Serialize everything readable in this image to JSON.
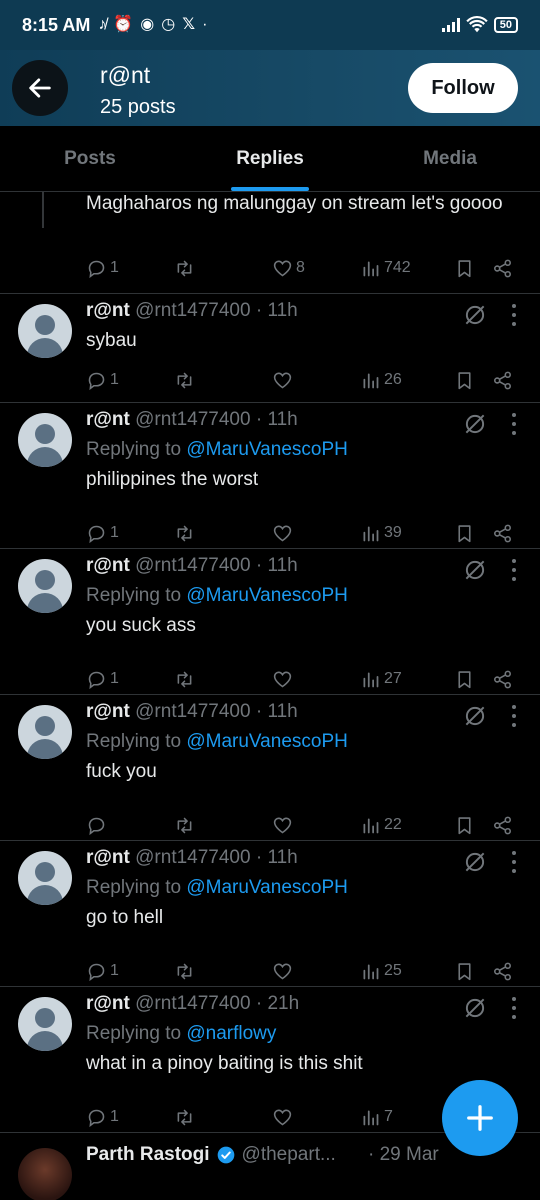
{
  "status_bar": {
    "time": "8:15 AM",
    "battery": "50"
  },
  "header": {
    "title": "r@nt",
    "subtitle": "25 posts",
    "follow_label": "Follow"
  },
  "tabs": [
    {
      "label": "Posts"
    },
    {
      "label": "Replies"
    },
    {
      "label": "Media"
    }
  ],
  "partial_tweet": {
    "text": "Maghaharos ng malunggay on stream let's goooo",
    "replies": "1",
    "likes": "8",
    "views": "742"
  },
  "tweets": [
    {
      "name": "r@nt",
      "handle": "@rnt1477400 · 11h",
      "replying_prefix": "",
      "replying_to": "",
      "text": "sybau",
      "replies": "1",
      "views": "26"
    },
    {
      "name": "r@nt",
      "handle": "@rnt1477400 · 11h",
      "replying_prefix": "Replying to ",
      "replying_to": "@MaruVanescoPH",
      "text": "philippines the worst",
      "replies": "1",
      "views": "39"
    },
    {
      "name": "r@nt",
      "handle": "@rnt1477400 · 11h",
      "replying_prefix": "Replying to ",
      "replying_to": "@MaruVanescoPH",
      "text": "you suck ass",
      "replies": "1",
      "views": "27"
    },
    {
      "name": "r@nt",
      "handle": "@rnt1477400 · 11h",
      "replying_prefix": "Replying to ",
      "replying_to": "@MaruVanescoPH",
      "text": "fuck you",
      "replies": "",
      "views": "22"
    },
    {
      "name": "r@nt",
      "handle": "@rnt1477400 · 11h",
      "replying_prefix": "Replying to ",
      "replying_to": "@MaruVanescoPH",
      "text": "go to hell",
      "replies": "1",
      "views": "25"
    },
    {
      "name": "r@nt",
      "handle": "@rnt1477400 · 21h",
      "replying_prefix": "Replying to ",
      "replying_to": "@narflowy",
      "text": "what in a pinoy baiting is this shit",
      "replies": "1",
      "views": "7"
    }
  ],
  "last_tweet": {
    "name": "Parth Rastogi",
    "handle": "@thepart...",
    "date": "· 29 Mar"
  },
  "icons": {
    "back": "arrow-left-icon",
    "reply": "reply-icon",
    "retweet": "retweet-icon",
    "like": "heart-icon",
    "views": "views-icon",
    "bookmark": "bookmark-icon",
    "share": "share-icon",
    "grok": "grok-icon",
    "more": "more-icon",
    "compose": "plus-icon"
  },
  "colors": {
    "accent": "#1d9bf0",
    "header_bg": "#174a66",
    "muted": "#71767b"
  }
}
